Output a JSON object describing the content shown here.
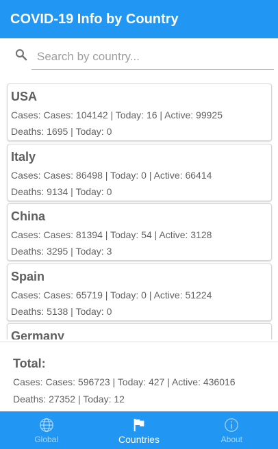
{
  "app": {
    "title": "COVID-19 Info by Country"
  },
  "search": {
    "placeholder": "Search by country...",
    "value": ""
  },
  "countries": [
    {
      "name": "USA",
      "cases_line": "Cases: Cases: 104142 | Today: 16 | Active: 99925",
      "deaths_line": "Deaths: 1695 | Today: 0"
    },
    {
      "name": "Italy",
      "cases_line": "Cases: Cases: 86498 | Today: 0 | Active: 66414",
      "deaths_line": "Deaths: 9134 | Today: 0"
    },
    {
      "name": "China",
      "cases_line": "Cases: Cases: 81394 | Today: 54 | Active: 3128",
      "deaths_line": "Deaths: 3295 | Today: 3"
    },
    {
      "name": "Spain",
      "cases_line": "Cases: Cases: 65719 | Today: 0 | Active: 51224",
      "deaths_line": "Deaths: 5138 | Today: 0"
    },
    {
      "name": "Germany",
      "cases_line": "",
      "deaths_line": ""
    }
  ],
  "total": {
    "title": "Total:",
    "cases_line": "Cases: Cases: 596723 | Today: 427 | Active: 436016",
    "deaths_line": "Deaths: 27352 | Today: 12"
  },
  "nav": {
    "items": [
      {
        "label": "Global",
        "icon": "globe-icon",
        "active": false
      },
      {
        "label": "Countries",
        "icon": "flag-icon",
        "active": true
      },
      {
        "label": "About",
        "icon": "info-icon",
        "active": false
      }
    ]
  },
  "colors": {
    "primary": "#2196f3",
    "text": "#616161"
  }
}
